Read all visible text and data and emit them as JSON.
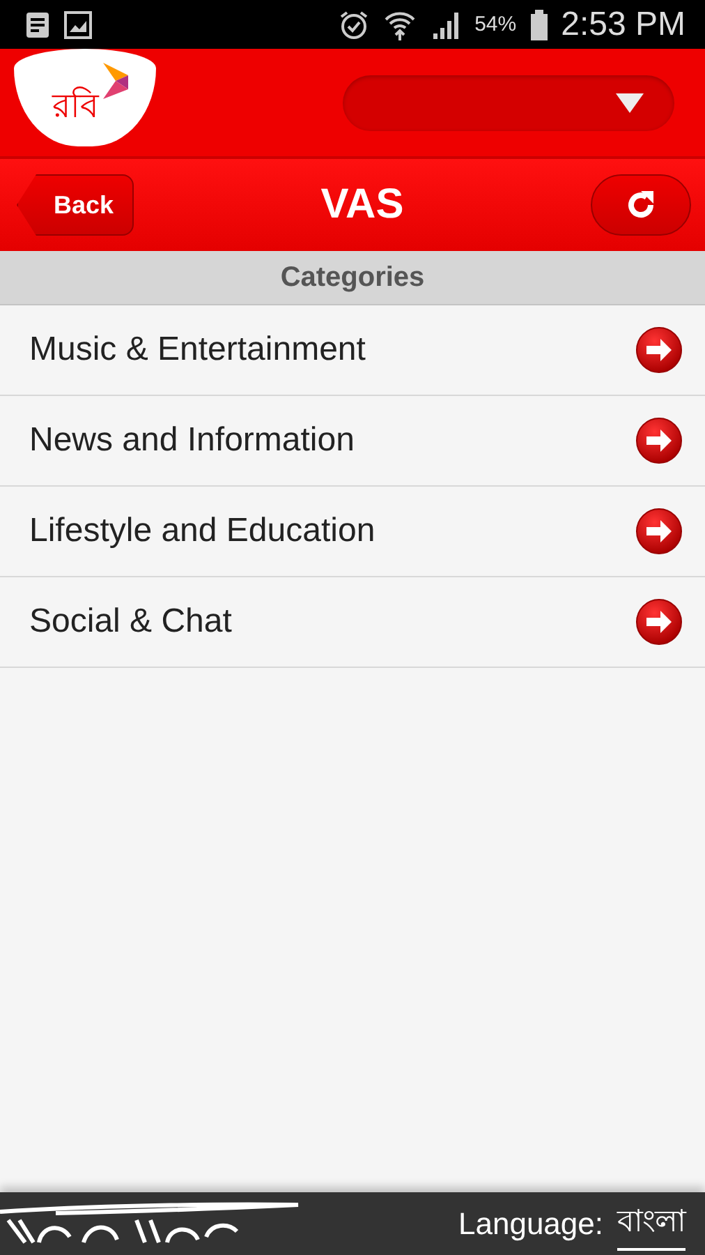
{
  "status_bar": {
    "battery": "54%",
    "time": "2:53 PM"
  },
  "header": {
    "logo_text": "রবি"
  },
  "title_bar": {
    "back": "Back",
    "title": "VAS"
  },
  "section": {
    "title": "Categories"
  },
  "categories": [
    {
      "label": "Music & Entertainment"
    },
    {
      "label": "News and Information"
    },
    {
      "label": "Lifestyle and Education"
    },
    {
      "label": "Social & Chat"
    }
  ],
  "footer": {
    "language_label": "Language:",
    "language_value": "বাংলা"
  }
}
